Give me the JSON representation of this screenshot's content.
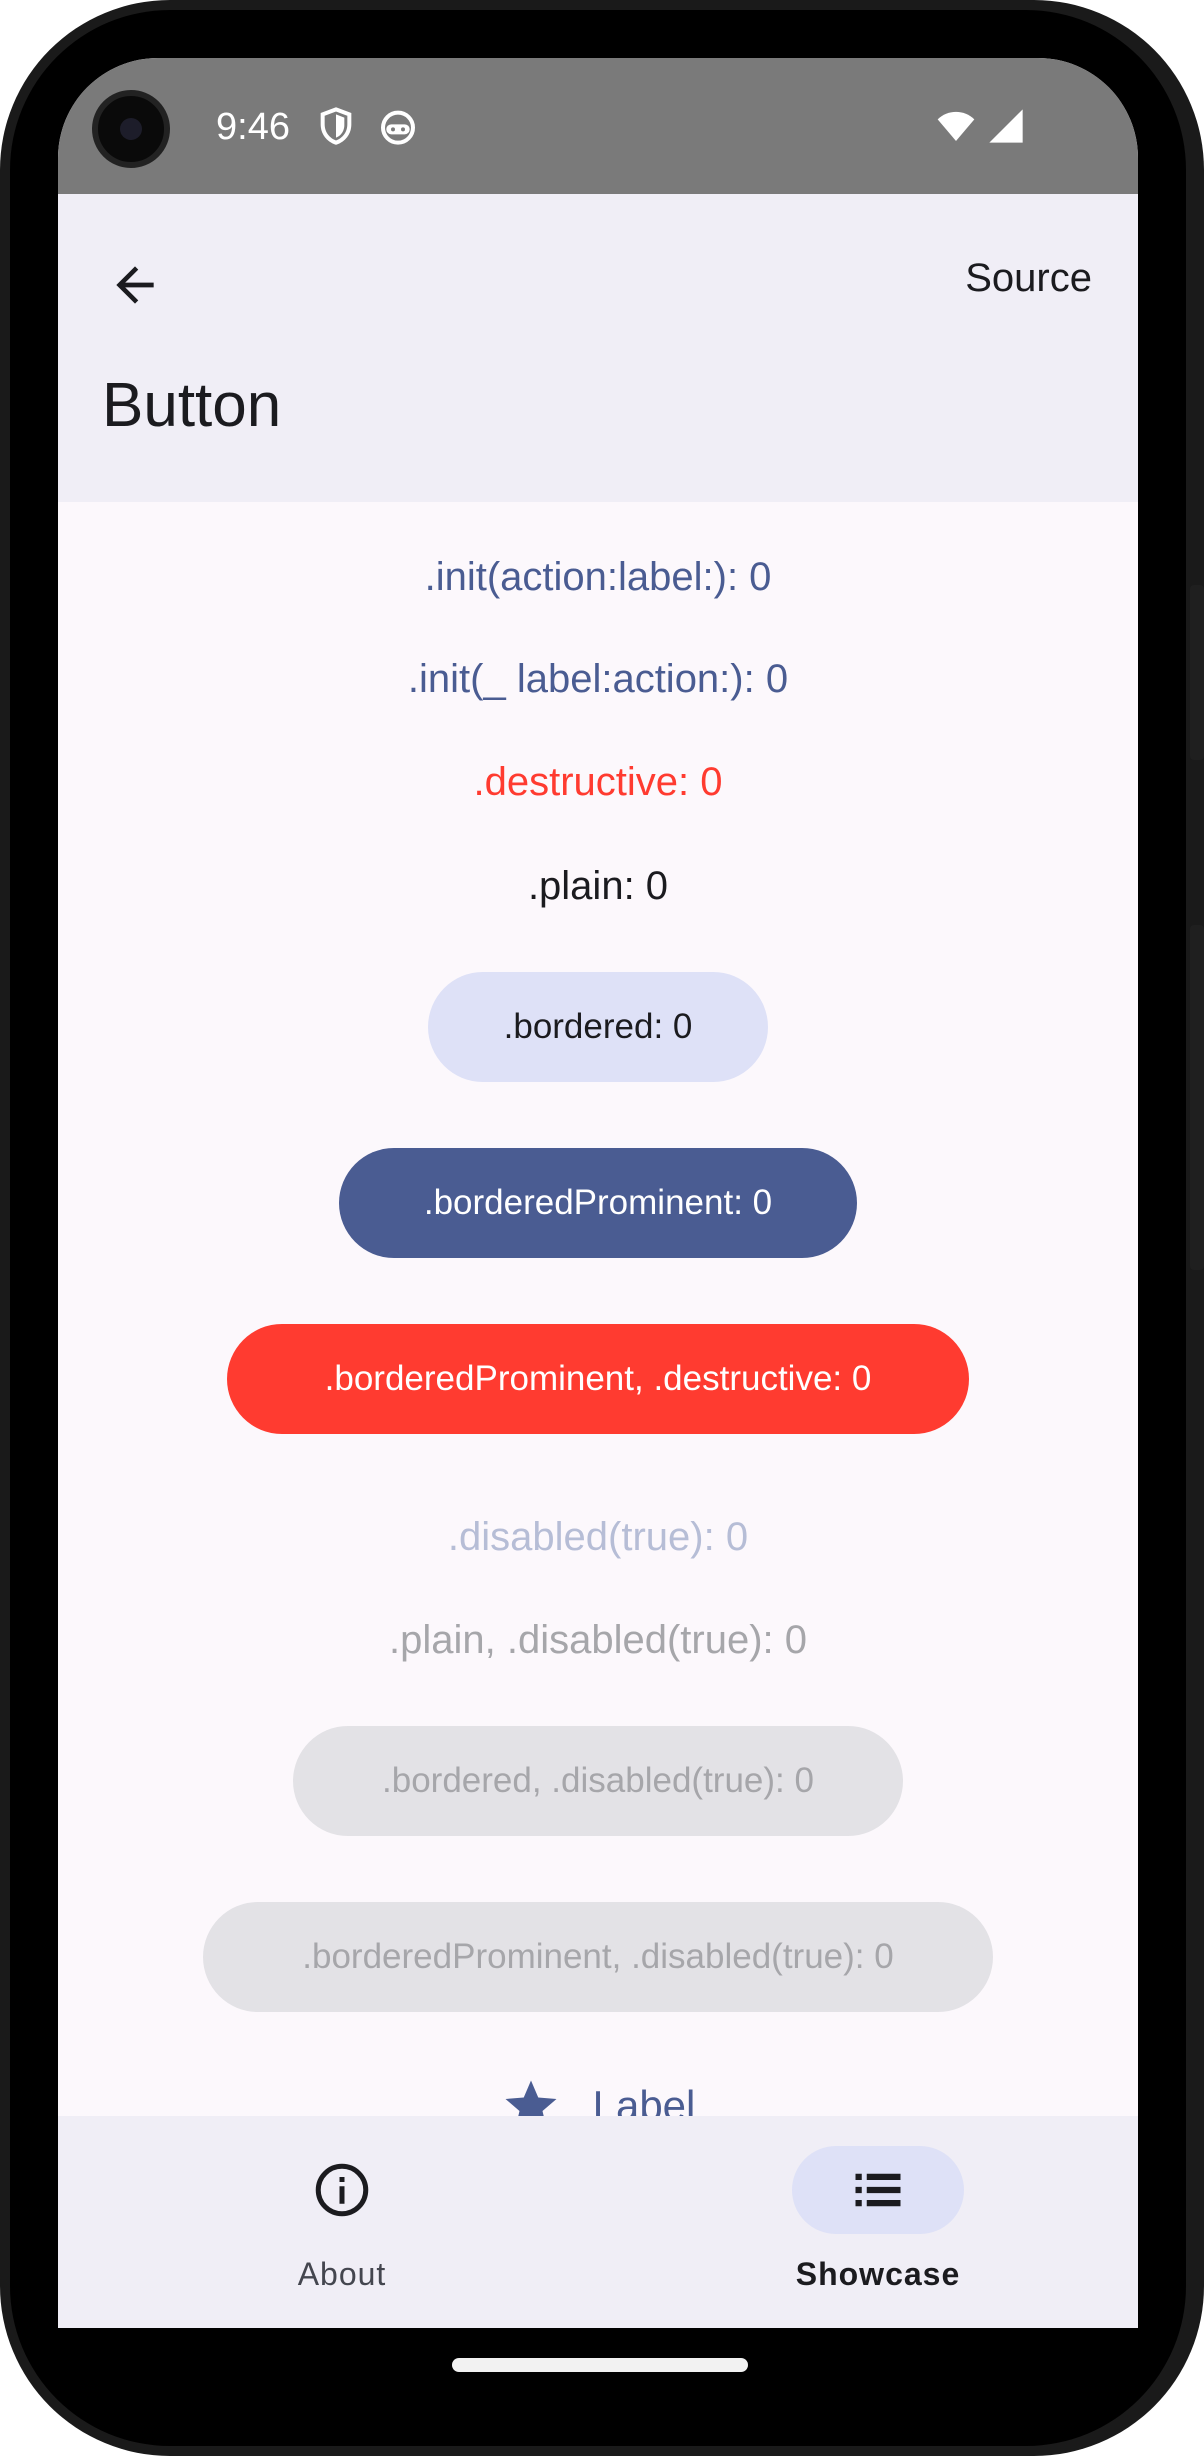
{
  "status_bar": {
    "time": "9:46"
  },
  "app_bar": {
    "title": "Button",
    "source_label": "Source"
  },
  "buttons": {
    "init_action_label": ".init(action:label:): 0",
    "init_label_action": ".init(_ label:action:): 0",
    "destructive": ".destructive: 0",
    "plain": ".plain: 0",
    "bordered": ".bordered: 0",
    "bordered_prominent": ".borderedProminent: 0",
    "bordered_prominent_destructive": ".borderedProminent, .destructive: 0",
    "disabled": ".disabled(true): 0",
    "plain_disabled": ".plain, .disabled(true): 0",
    "bordered_disabled": ".bordered, .disabled(true): 0",
    "bordered_prominent_disabled": ".borderedProminent, .disabled(true): 0",
    "label": "Label"
  },
  "bottom_nav": {
    "items": [
      {
        "label": "About",
        "icon": "info-icon",
        "selected": false
      },
      {
        "label": "Showcase",
        "icon": "list-icon",
        "selected": true
      }
    ]
  },
  "colors": {
    "primary": "#4a5c92",
    "destructive": "#ff3b30",
    "bordered_bg": "#dee1f7",
    "disabled_bg": "#e3e2e6",
    "surface": "#fcf8fc",
    "app_bar_bg": "#f0eef6"
  }
}
